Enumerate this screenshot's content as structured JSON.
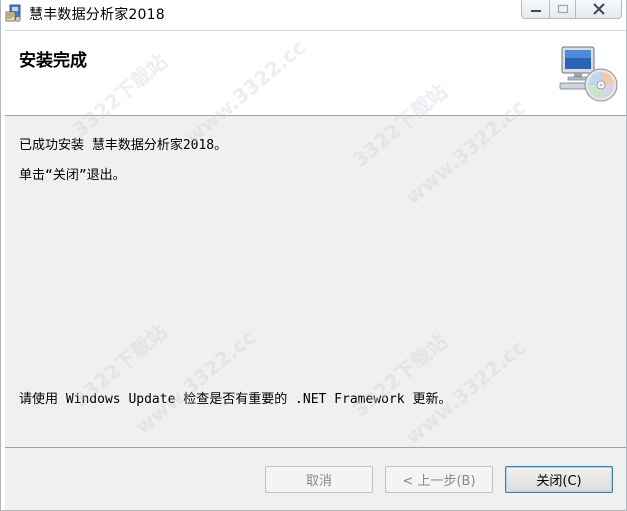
{
  "window": {
    "title": "慧丰数据分析家2018",
    "icons": {
      "app": "installer-icon",
      "minimize": "minimize-icon",
      "maximize": "maximize-icon",
      "close": "close-icon"
    }
  },
  "header": {
    "title": "安装完成",
    "icon": "computer-cd-icon"
  },
  "body": {
    "line1": "已成功安装 慧丰数据分析家2018。",
    "line2": "单击“关闭”退出。",
    "line3": "请使用 Windows Update 检查是否有重要的 .NET Framework 更新。"
  },
  "buttons": {
    "cancel": "取消",
    "back": "< 上一步(B)",
    "close": "关闭(C)"
  },
  "watermark": [
    "3322下载站",
    "www.3322.cc"
  ],
  "colors": {
    "body_bg": "#f0f0f0",
    "close_button_border": "#3c7fb1"
  }
}
